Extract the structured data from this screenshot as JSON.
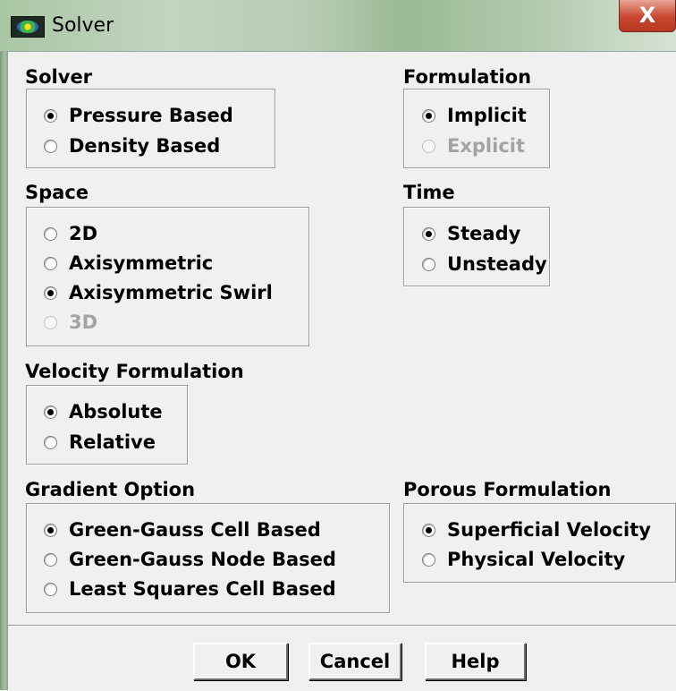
{
  "window": {
    "title": "Solver",
    "close_label": "X"
  },
  "groups": {
    "solver": {
      "title": "Solver",
      "options": [
        "Pressure Based",
        "Density Based"
      ],
      "selected": "Pressure Based"
    },
    "formulation": {
      "title": "Formulation",
      "options": [
        "Implicit",
        "Explicit"
      ],
      "selected": "Implicit",
      "disabled": [
        "Explicit"
      ]
    },
    "space": {
      "title": "Space",
      "options": [
        "2D",
        "Axisymmetric",
        "Axisymmetric Swirl",
        "3D"
      ],
      "selected": "Axisymmetric Swirl",
      "disabled": [
        "3D"
      ]
    },
    "time": {
      "title": "Time",
      "options": [
        "Steady",
        "Unsteady"
      ],
      "selected": "Steady"
    },
    "velocity": {
      "title": "Velocity Formulation",
      "options": [
        "Absolute",
        "Relative"
      ],
      "selected": "Absolute"
    },
    "gradient": {
      "title": "Gradient Option",
      "options": [
        "Green-Gauss Cell Based",
        "Green-Gauss Node Based",
        "Least Squares Cell Based"
      ],
      "selected": "Green-Gauss Cell Based"
    },
    "porous": {
      "title": "Porous Formulation",
      "options": [
        "Superficial Velocity",
        "Physical Velocity"
      ],
      "selected": "Superficial Velocity"
    }
  },
  "buttons": {
    "ok": "OK",
    "cancel": "Cancel",
    "help": "Help"
  }
}
